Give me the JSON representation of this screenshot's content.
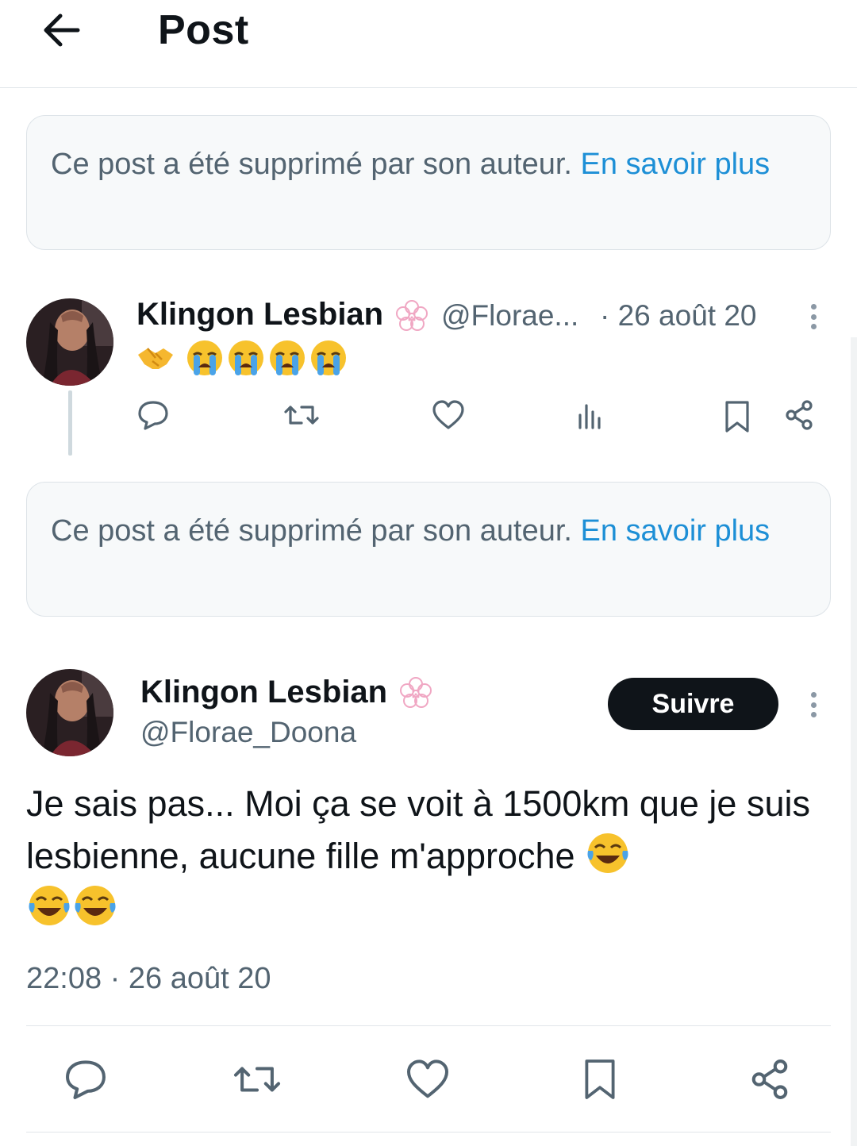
{
  "header": {
    "title": "Post",
    "back_icon": "arrow-left-icon"
  },
  "deleted_notice_1": {
    "text": "Ce post a été supprimé par son auteur. ",
    "link": "En savoir plus"
  },
  "reply": {
    "name": "Klingon Lesbian",
    "handle": "@Florae...",
    "date": "· 26 août 20",
    "emojis": [
      "🤝",
      "😭",
      "😭",
      "😭",
      "😭"
    ]
  },
  "deleted_notice_2": {
    "text": "Ce post a été supprimé par son auteur. ",
    "link": "En savoir plus"
  },
  "main": {
    "name": "Klingon Lesbian",
    "handle": "@Florae_Doona",
    "follow_label": "Suivre",
    "text": "Je sais pas... Moi ça se voit à 1500km que je suis lesbienne, aucune fille m'approche",
    "timestamp": "22:08 · 26 août 20"
  },
  "colors": {
    "link": "#1d8fd6",
    "muted": "#536471",
    "text": "#0f1419",
    "badge": "#f0a7c3"
  }
}
